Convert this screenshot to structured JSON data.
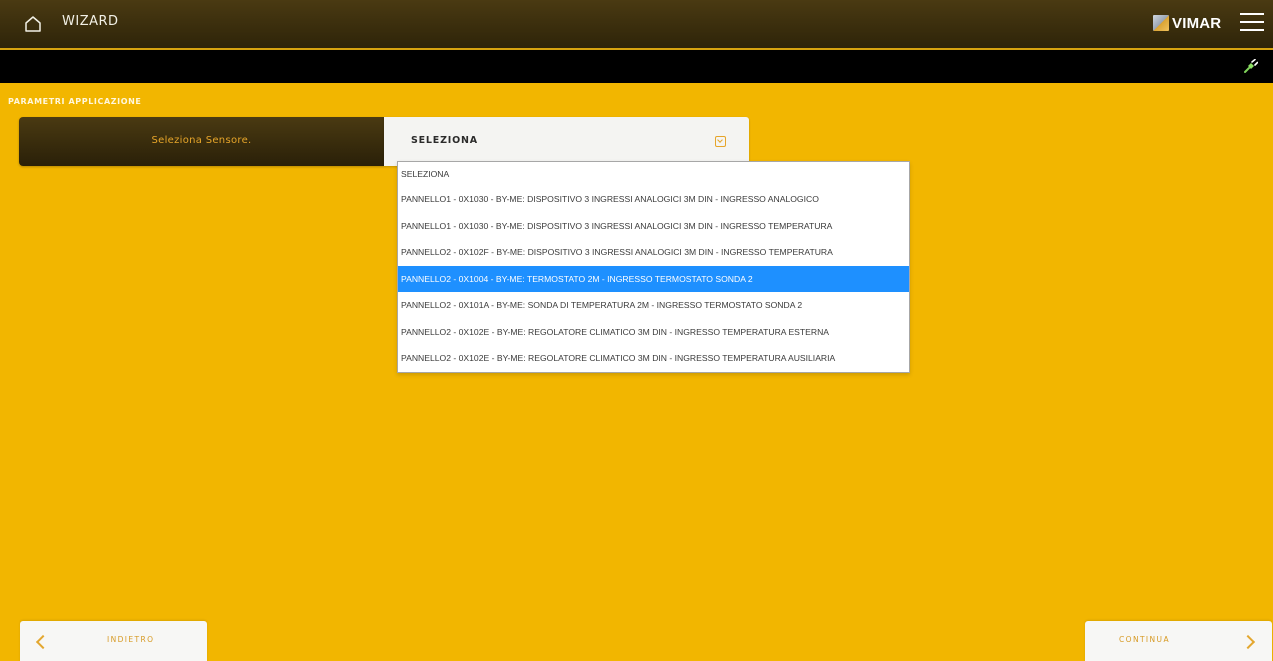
{
  "header": {
    "title": "WIZARD",
    "brand": "VIMAR"
  },
  "section": {
    "title": "PARAMETRI APPLICAZIONE"
  },
  "param": {
    "label": "Seleziona Sensore.",
    "selected_value": "SELEZIONA",
    "options": [
      "SELEZIONA",
      "PANNELLO1 - 0X1030 - BY-ME: DISPOSITIVO 3 INGRESSI ANALOGICI 3M DIN - INGRESSO ANALOGICO",
      "PANNELLO1 - 0X1030 - BY-ME: DISPOSITIVO 3 INGRESSI ANALOGICI 3M DIN - INGRESSO TEMPERATURA",
      "PANNELLO2 - 0X102F - BY-ME: DISPOSITIVO 3 INGRESSI ANALOGICI 3M DIN - INGRESSO TEMPERATURA",
      "PANNELLO2 - 0X1004 - BY-ME: TERMOSTATO 2M - INGRESSO TERMOSTATO SONDA 2",
      "PANNELLO2 - 0X101A - BY-ME: SONDA DI TEMPERATURA 2M - INGRESSO TERMOSTATO SONDA 2",
      "PANNELLO2 - 0X102E - BY-ME: REGOLATORE CLIMATICO 3M DIN - INGRESSO TEMPERATURA ESTERNA",
      "PANNELLO2 - 0X102E - BY-ME: REGOLATORE CLIMATICO 3M DIN - INGRESSO TEMPERATURA AUSILIARIA"
    ],
    "highlighted_index": 4
  },
  "footer": {
    "back_label": "INDIETRO",
    "next_label": "CONTINUA"
  },
  "colors": {
    "background": "#f2b600",
    "header": "#3a2d0e",
    "accent": "#e6a52a",
    "highlight": "#1e90ff"
  },
  "icons": {
    "home": "home-icon",
    "menu": "hamburger-menu-icon",
    "connection": "plug-connection-icon",
    "back": "chevron-left-icon",
    "next": "chevron-right-icon",
    "dropdown": "chevron-down-icon"
  }
}
